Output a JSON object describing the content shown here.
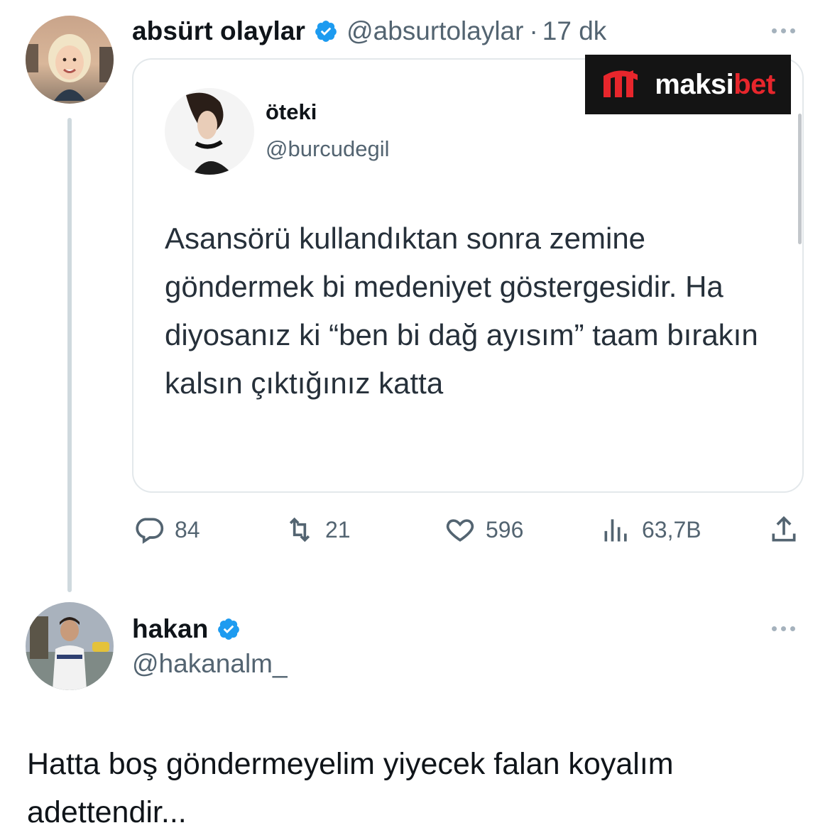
{
  "tweet": {
    "author_name": "absürt olaylar",
    "author_handle": "@absurtolaylar",
    "separator": "·",
    "timestamp": "17 dk",
    "quote": {
      "name": "öteki",
      "handle": "@burcudegil",
      "text": "Asansörü kullandıktan sonra zemine göndermek bi medeniyet göstergesidir. Ha diyosanız ki “ben bi dağ ayısım” taam bırakın kalsın çıktığınız katta"
    },
    "ad": {
      "brand_prefix": "maksi",
      "brand_suffix": "bet",
      "accent_color": "#e7262c"
    },
    "actions": {
      "replies": "84",
      "retweets": "21",
      "likes": "596",
      "views": "63,7B"
    }
  },
  "reply": {
    "author_name": "hakan",
    "author_handle": "@hakanalm_",
    "text": "Hatta boş göndermeyelim yiyecek falan koyalım adettendir..."
  },
  "colors": {
    "verified_blue": "#1d9bf0",
    "secondary_text": "#536471",
    "border": "#e3e8eb"
  },
  "icons": [
    "verified-badge-icon",
    "more-icon",
    "reply-icon",
    "retweet-icon",
    "like-icon",
    "views-icon",
    "share-icon"
  ]
}
